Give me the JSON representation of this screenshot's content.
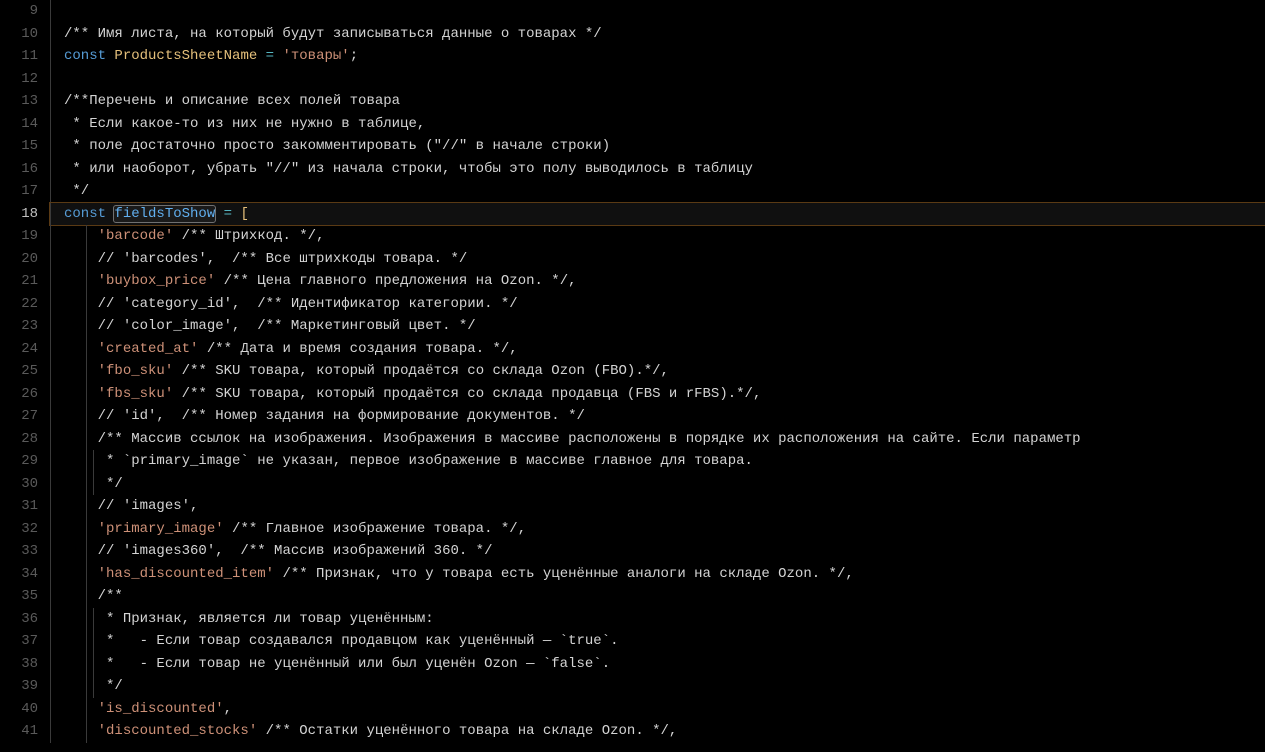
{
  "startLine": 9,
  "highlightedLine": 18,
  "highlightedWord": "fieldsToShow",
  "lines": [
    {
      "n": 9,
      "guides": [
        0
      ],
      "t": []
    },
    {
      "n": 10,
      "guides": [
        0
      ],
      "t": [
        [
          "doc",
          "/** Имя листа, на который будут записываться данные о товарах */"
        ]
      ]
    },
    {
      "n": 11,
      "guides": [
        0
      ],
      "t": [
        [
          "kw",
          "const"
        ],
        [
          "p",
          " "
        ],
        [
          "ident",
          "ProductsSheetName"
        ],
        [
          "p",
          " "
        ],
        [
          "op",
          "="
        ],
        [
          "p",
          " "
        ],
        [
          "str",
          "'товары'"
        ],
        [
          "p",
          ";"
        ]
      ]
    },
    {
      "n": 12,
      "guides": [
        0
      ],
      "t": []
    },
    {
      "n": 13,
      "guides": [
        0
      ],
      "t": [
        [
          "doc",
          "/**Перечень и описание всех полей товара"
        ]
      ]
    },
    {
      "n": 14,
      "guides": [
        0
      ],
      "t": [
        [
          "doc",
          " * Если какое-то из них не нужно в таблице,"
        ]
      ]
    },
    {
      "n": 15,
      "guides": [
        0
      ],
      "t": [
        [
          "doc",
          " * поле достаточно просто закомментировать (\"//\" в начале строки)"
        ]
      ]
    },
    {
      "n": 16,
      "guides": [
        0
      ],
      "t": [
        [
          "doc",
          " * или наоборот, убрать \"//\" из начала строки, чтобы это полу выводилось в таблицу"
        ]
      ]
    },
    {
      "n": 17,
      "guides": [
        0
      ],
      "t": [
        [
          "doc",
          " */"
        ]
      ]
    },
    {
      "n": 18,
      "guides": [
        0
      ],
      "t": [
        [
          "kw",
          "const"
        ],
        [
          "p",
          " "
        ],
        [
          "fnbox",
          "fieldsToShow"
        ],
        [
          "p",
          " "
        ],
        [
          "op",
          "="
        ],
        [
          "p",
          " "
        ],
        [
          "bry",
          "["
        ]
      ]
    },
    {
      "n": 19,
      "guides": [
        0,
        1
      ],
      "t": [
        [
          "p",
          "    "
        ],
        [
          "str",
          "'barcode'"
        ],
        [
          "p",
          " "
        ],
        [
          "doc",
          "/** Штрихкод. */"
        ],
        [
          "p",
          ","
        ]
      ]
    },
    {
      "n": 20,
      "guides": [
        0,
        1
      ],
      "t": [
        [
          "p",
          "    "
        ],
        [
          "doc",
          "// 'barcodes',  /** Все штрихкоды товара. */"
        ]
      ]
    },
    {
      "n": 21,
      "guides": [
        0,
        1
      ],
      "t": [
        [
          "p",
          "    "
        ],
        [
          "str",
          "'buybox_price'"
        ],
        [
          "p",
          " "
        ],
        [
          "doc",
          "/** Цена главного предложения на Ozon. */"
        ],
        [
          "p",
          ","
        ]
      ]
    },
    {
      "n": 22,
      "guides": [
        0,
        1
      ],
      "t": [
        [
          "p",
          "    "
        ],
        [
          "doc",
          "// 'category_id',  /** Идентификатор категории. */"
        ]
      ]
    },
    {
      "n": 23,
      "guides": [
        0,
        1
      ],
      "t": [
        [
          "p",
          "    "
        ],
        [
          "doc",
          "// 'color_image',  /** Маркетинговый цвет. */"
        ]
      ]
    },
    {
      "n": 24,
      "guides": [
        0,
        1
      ],
      "t": [
        [
          "p",
          "    "
        ],
        [
          "str",
          "'created_at'"
        ],
        [
          "p",
          " "
        ],
        [
          "doc",
          "/** Дата и время создания товара. */"
        ],
        [
          "p",
          ","
        ]
      ]
    },
    {
      "n": 25,
      "guides": [
        0,
        1
      ],
      "t": [
        [
          "p",
          "    "
        ],
        [
          "str",
          "'fbo_sku'"
        ],
        [
          "p",
          " "
        ],
        [
          "doc",
          "/** SKU товара, который продаётся со склада Ozon (FBO).*/"
        ],
        [
          "p",
          ","
        ]
      ]
    },
    {
      "n": 26,
      "guides": [
        0,
        1
      ],
      "t": [
        [
          "p",
          "    "
        ],
        [
          "str",
          "'fbs_sku'"
        ],
        [
          "p",
          " "
        ],
        [
          "doc",
          "/** SKU товара, который продаётся со склада продавца (FBS и rFBS).*/"
        ],
        [
          "p",
          ","
        ]
      ]
    },
    {
      "n": 27,
      "guides": [
        0,
        1
      ],
      "t": [
        [
          "p",
          "    "
        ],
        [
          "doc",
          "// 'id',  /** Номер задания на формирование документов. */"
        ]
      ]
    },
    {
      "n": 28,
      "guides": [
        0,
        1
      ],
      "t": [
        [
          "p",
          "    "
        ],
        [
          "doc",
          "/** Массив ссылок на изображения. Изображения в массиве расположены в порядке их расположения на сайте. Если параметр"
        ]
      ]
    },
    {
      "n": 29,
      "guides": [
        0,
        1,
        2
      ],
      "t": [
        [
          "p",
          "    "
        ],
        [
          "doc",
          " * `primary_image` не указан, первое изображение в массиве главное для товара."
        ]
      ]
    },
    {
      "n": 30,
      "guides": [
        0,
        1,
        2
      ],
      "t": [
        [
          "p",
          "    "
        ],
        [
          "doc",
          " */"
        ]
      ]
    },
    {
      "n": 31,
      "guides": [
        0,
        1
      ],
      "t": [
        [
          "p",
          "    "
        ],
        [
          "doc",
          "// 'images',"
        ]
      ]
    },
    {
      "n": 32,
      "guides": [
        0,
        1
      ],
      "t": [
        [
          "p",
          "    "
        ],
        [
          "str",
          "'primary_image'"
        ],
        [
          "p",
          " "
        ],
        [
          "doc",
          "/** Главное изображение товара. */"
        ],
        [
          "p",
          ","
        ]
      ]
    },
    {
      "n": 33,
      "guides": [
        0,
        1
      ],
      "t": [
        [
          "p",
          "    "
        ],
        [
          "doc",
          "// 'images360',  /** Массив изображений 360. */"
        ]
      ]
    },
    {
      "n": 34,
      "guides": [
        0,
        1
      ],
      "t": [
        [
          "p",
          "    "
        ],
        [
          "str",
          "'has_discounted_item'"
        ],
        [
          "p",
          " "
        ],
        [
          "doc",
          "/** Признак, что у товара есть уценённые аналоги на складе Ozon. */"
        ],
        [
          "p",
          ","
        ]
      ]
    },
    {
      "n": 35,
      "guides": [
        0,
        1
      ],
      "t": [
        [
          "p",
          "    "
        ],
        [
          "doc",
          "/**"
        ]
      ]
    },
    {
      "n": 36,
      "guides": [
        0,
        1,
        2
      ],
      "t": [
        [
          "p",
          "    "
        ],
        [
          "doc",
          " * Признак, является ли товар уценённым:"
        ]
      ]
    },
    {
      "n": 37,
      "guides": [
        0,
        1,
        2
      ],
      "t": [
        [
          "p",
          "    "
        ],
        [
          "doc",
          " *   - Если товар создавался продавцом как уценённый — `true`."
        ]
      ]
    },
    {
      "n": 38,
      "guides": [
        0,
        1,
        2
      ],
      "t": [
        [
          "p",
          "    "
        ],
        [
          "doc",
          " *   - Если товар не уценённый или был уценён Ozon — `false`."
        ]
      ]
    },
    {
      "n": 39,
      "guides": [
        0,
        1,
        2
      ],
      "t": [
        [
          "p",
          "    "
        ],
        [
          "doc",
          " */"
        ]
      ]
    },
    {
      "n": 40,
      "guides": [
        0,
        1
      ],
      "t": [
        [
          "p",
          "    "
        ],
        [
          "str",
          "'is_discounted'"
        ],
        [
          "p",
          ","
        ]
      ]
    },
    {
      "n": 41,
      "guides": [
        0,
        1
      ],
      "t": [
        [
          "p",
          "    "
        ],
        [
          "str",
          "'discounted_stocks'"
        ],
        [
          "p",
          " "
        ],
        [
          "doc",
          "/** Остатки уценённого товара на складе Ozon. */"
        ],
        [
          "p",
          ","
        ]
      ]
    }
  ],
  "guideOffsets": [
    0,
    36,
    43
  ]
}
